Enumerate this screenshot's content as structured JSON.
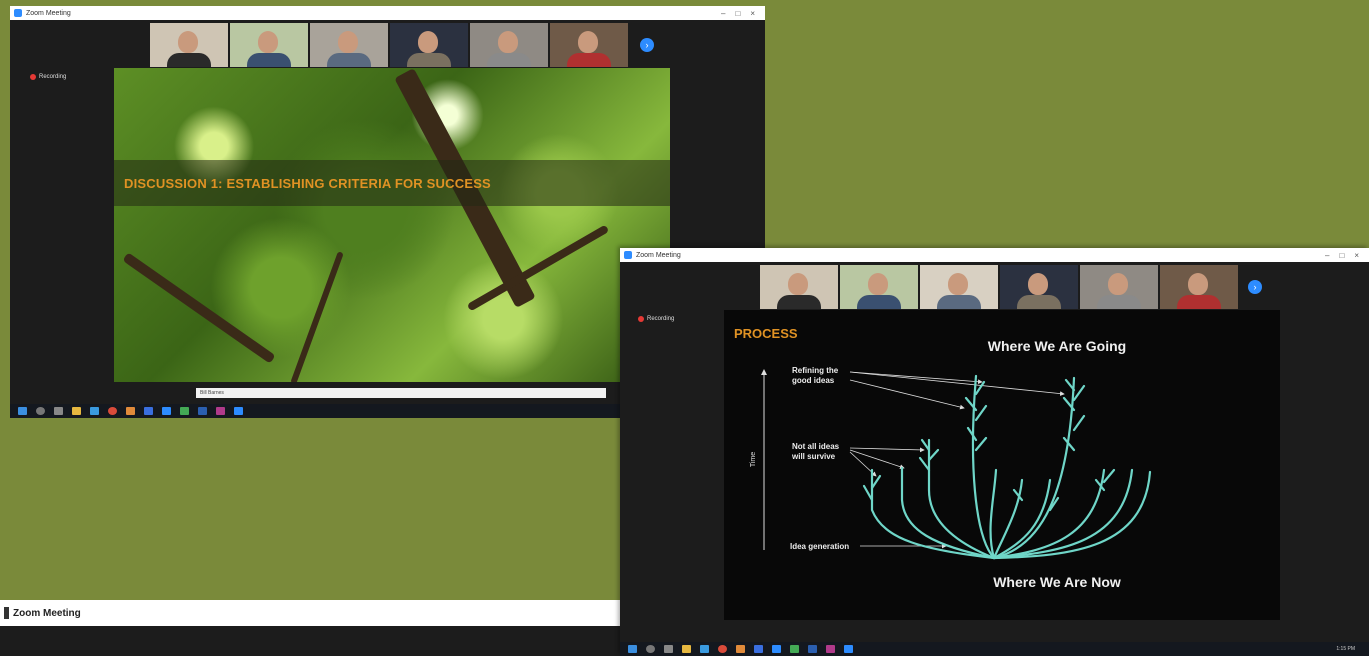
{
  "window1": {
    "title": "Zoom Meeting",
    "recording_label": "Recording",
    "slide_banner": "DISCUSSION 1: ESTABLISHING CRITERIA FOR SUCCESS",
    "name_bar": "Bill Barnes"
  },
  "window2": {
    "title": "Zoom Meeting",
    "recording_label": "Recording",
    "slide": {
      "heading": "PROCESS",
      "top_caption": "Where We Are Going",
      "bottom_caption": "Where We Are Now",
      "axis_label": "Time",
      "label_refining_1": "Refining the",
      "label_refining_2": "good ideas",
      "label_survive_1": "Not all ideas",
      "label_survive_2": "will survive",
      "label_generation": "Idea generation"
    },
    "clock": "1:15 PM"
  },
  "window3": {
    "title": "Zoom Meeting"
  },
  "colors": {
    "background": "#7a8a3a",
    "slide_accent": "#e09224",
    "tree_lines": "#6fd6c8",
    "zoom_blue": "#2d8cff"
  }
}
